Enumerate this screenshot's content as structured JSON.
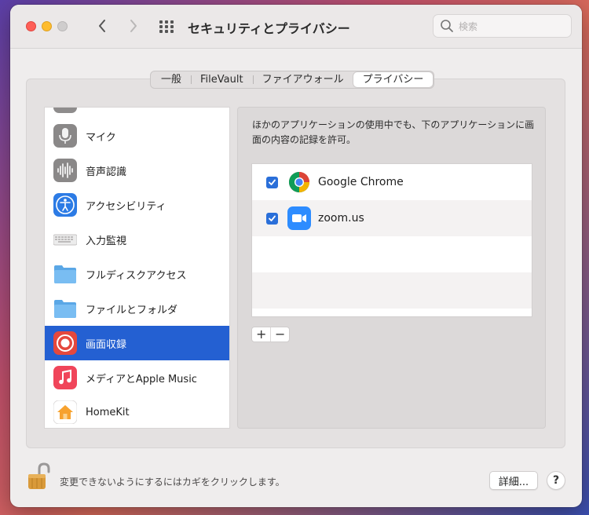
{
  "window": {
    "title": "セキュリティとプライバシー"
  },
  "search": {
    "placeholder": "検索"
  },
  "tabs": [
    {
      "label": "一般",
      "active": false
    },
    {
      "label": "FileVault",
      "active": false
    },
    {
      "label": "ファイアウォール",
      "active": false
    },
    {
      "label": "プライバシー",
      "active": true
    }
  ],
  "sidebar": {
    "items": [
      {
        "label": "マイク",
        "icon": "microphone-icon"
      },
      {
        "label": "音声認識",
        "icon": "speech-recognition-icon"
      },
      {
        "label": "アクセシビリティ",
        "icon": "accessibility-icon"
      },
      {
        "label": "入力監視",
        "icon": "keyboard-icon"
      },
      {
        "label": "フルディスクアクセス",
        "icon": "folder-icon"
      },
      {
        "label": "ファイルとフォルダ",
        "icon": "folder-icon"
      },
      {
        "label": "画面収録",
        "icon": "screen-recording-icon",
        "selected": true
      },
      {
        "label": "メディアとApple Music",
        "icon": "music-icon"
      },
      {
        "label": "HomeKit",
        "icon": "homekit-icon"
      }
    ]
  },
  "panel": {
    "description": "ほかのアプリケーションの使用中でも、下のアプリケーションに画面の内容の記録を許可。",
    "apps": [
      {
        "name": "Google Chrome",
        "checked": true,
        "icon": "chrome-icon"
      },
      {
        "name": "zoom.us",
        "checked": true,
        "icon": "zoom-icon"
      }
    ],
    "add_label": "+",
    "remove_label": "−"
  },
  "footer": {
    "lock_text": "変更できないようにするにはカギをクリックします。",
    "details_label": "詳細...",
    "help_label": "?"
  },
  "colors": {
    "selection": "#2460d2",
    "checkbox": "#2a6fd9"
  }
}
